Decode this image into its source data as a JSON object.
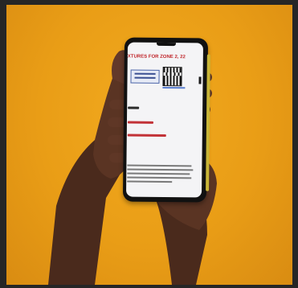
{
  "image": {
    "description_colors": {
      "background": "#e99d16",
      "skin": "#5a3423",
      "phone_body": "#111111",
      "screen": "#f4f4f6",
      "accent_red": "#c0282d"
    }
  },
  "phone_screen": {
    "title": "XTURES FOR ZONE 2, 22"
  }
}
